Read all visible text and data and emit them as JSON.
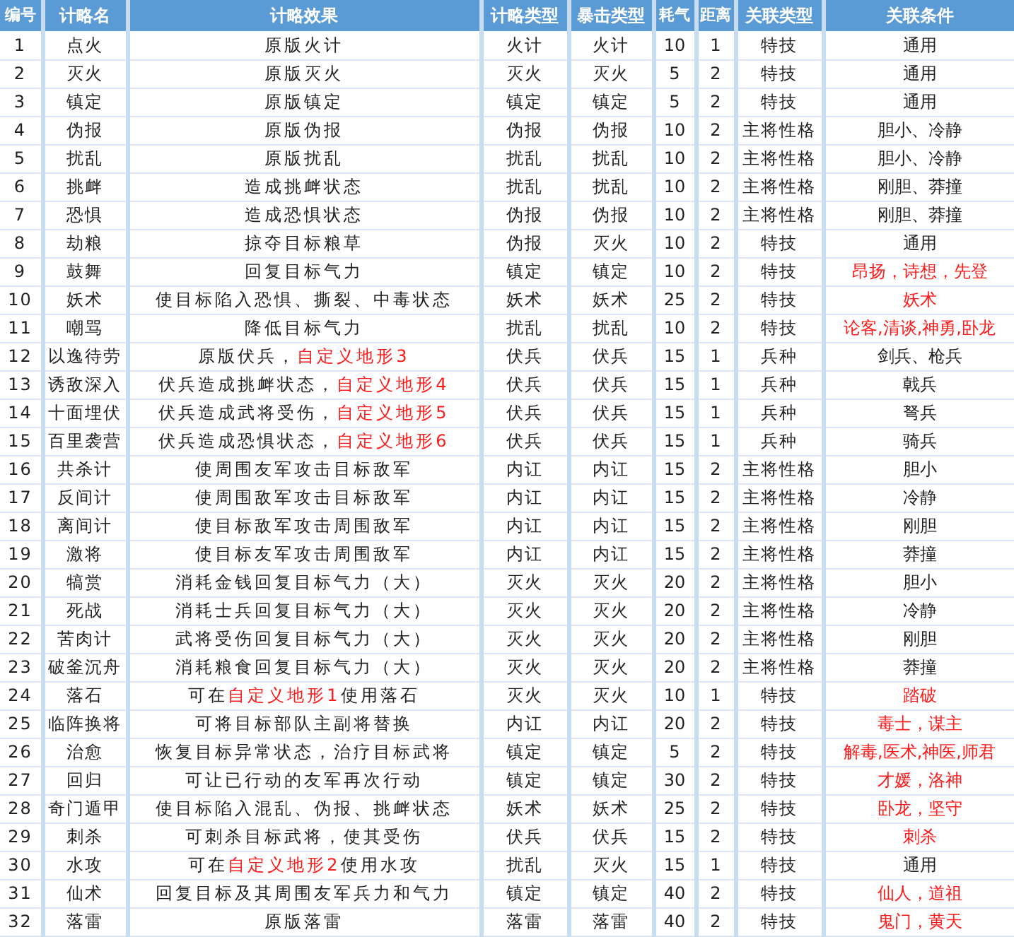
{
  "table": {
    "columns": [
      "编号",
      "计略名",
      "计略效果",
      "计略类型",
      "暴击类型",
      "耗气",
      "距离",
      "关联类型",
      "关联条件"
    ],
    "rows": [
      {
        "no": "1",
        "name": "点火",
        "effect": [
          {
            "text": "原版火计",
            "highlight": false
          }
        ],
        "type": "火计",
        "crit": "火计",
        "cost": "10",
        "range": "1",
        "link": "特技",
        "condition": "通用",
        "condition_highlight": false
      },
      {
        "no": "2",
        "name": "灭火",
        "effect": [
          {
            "text": "原版灭火",
            "highlight": false
          }
        ],
        "type": "灭火",
        "crit": "灭火",
        "cost": "5",
        "range": "2",
        "link": "特技",
        "condition": "通用",
        "condition_highlight": false
      },
      {
        "no": "3",
        "name": "镇定",
        "effect": [
          {
            "text": "原版镇定",
            "highlight": false
          }
        ],
        "type": "镇定",
        "crit": "镇定",
        "cost": "5",
        "range": "2",
        "link": "特技",
        "condition": "通用",
        "condition_highlight": false
      },
      {
        "no": "4",
        "name": "伪报",
        "effect": [
          {
            "text": "原版伪报",
            "highlight": false
          }
        ],
        "type": "伪报",
        "crit": "伪报",
        "cost": "10",
        "range": "2",
        "link": "主将性格",
        "condition": "胆小、冷静",
        "condition_highlight": false
      },
      {
        "no": "5",
        "name": "扰乱",
        "effect": [
          {
            "text": "原版扰乱",
            "highlight": false
          }
        ],
        "type": "扰乱",
        "crit": "扰乱",
        "cost": "10",
        "range": "2",
        "link": "主将性格",
        "condition": "胆小、冷静",
        "condition_highlight": false
      },
      {
        "no": "6",
        "name": "挑衅",
        "effect": [
          {
            "text": "造成挑衅状态",
            "highlight": false
          }
        ],
        "type": "扰乱",
        "crit": "扰乱",
        "cost": "10",
        "range": "2",
        "link": "主将性格",
        "condition": "刚胆、莽撞",
        "condition_highlight": false
      },
      {
        "no": "7",
        "name": "恐惧",
        "effect": [
          {
            "text": "造成恐惧状态",
            "highlight": false
          }
        ],
        "type": "伪报",
        "crit": "伪报",
        "cost": "10",
        "range": "2",
        "link": "主将性格",
        "condition": "刚胆、莽撞",
        "condition_highlight": false
      },
      {
        "no": "8",
        "name": "劫粮",
        "effect": [
          {
            "text": "掠夺目标粮草",
            "highlight": false
          }
        ],
        "type": "伪报",
        "crit": "灭火",
        "cost": "10",
        "range": "2",
        "link": "特技",
        "condition": "通用",
        "condition_highlight": false
      },
      {
        "no": "9",
        "name": "鼓舞",
        "effect": [
          {
            "text": "回复目标气力",
            "highlight": false
          }
        ],
        "type": "镇定",
        "crit": "镇定",
        "cost": "10",
        "range": "2",
        "link": "特技",
        "condition": "昂扬，诗想，先登",
        "condition_highlight": true
      },
      {
        "no": "10",
        "name": "妖术",
        "effect": [
          {
            "text": "使目标陷入恐惧、撕裂、中毒状态",
            "highlight": false
          }
        ],
        "type": "妖术",
        "crit": "妖术",
        "cost": "25",
        "range": "2",
        "link": "特技",
        "condition": "妖术",
        "condition_highlight": true
      },
      {
        "no": "11",
        "name": "嘲骂",
        "effect": [
          {
            "text": "降低目标气力",
            "highlight": false
          }
        ],
        "type": "扰乱",
        "crit": "扰乱",
        "cost": "10",
        "range": "2",
        "link": "特技",
        "condition": "论客,清谈,神勇,卧龙",
        "condition_highlight": true
      },
      {
        "no": "12",
        "name": "以逸待劳",
        "effect": [
          {
            "text": "原版伏兵，",
            "highlight": false
          },
          {
            "text": "自定义地形3",
            "highlight": true
          }
        ],
        "type": "伏兵",
        "crit": "伏兵",
        "cost": "15",
        "range": "1",
        "link": "兵种",
        "condition": "剑兵、枪兵",
        "condition_highlight": false
      },
      {
        "no": "13",
        "name": "诱敌深入",
        "effect": [
          {
            "text": "伏兵造成挑衅状态，",
            "highlight": false
          },
          {
            "text": "自定义地形4",
            "highlight": true
          }
        ],
        "type": "伏兵",
        "crit": "伏兵",
        "cost": "15",
        "range": "1",
        "link": "兵种",
        "condition": "戟兵",
        "condition_highlight": false
      },
      {
        "no": "14",
        "name": "十面埋伏",
        "effect": [
          {
            "text": "伏兵造成武将受伤，",
            "highlight": false
          },
          {
            "text": "自定义地形5",
            "highlight": true
          }
        ],
        "type": "伏兵",
        "crit": "伏兵",
        "cost": "15",
        "range": "1",
        "link": "兵种",
        "condition": "弩兵",
        "condition_highlight": false
      },
      {
        "no": "15",
        "name": "百里袭营",
        "effect": [
          {
            "text": "伏兵造成恐惧状态，",
            "highlight": false
          },
          {
            "text": "自定义地形6",
            "highlight": true
          }
        ],
        "type": "伏兵",
        "crit": "伏兵",
        "cost": "15",
        "range": "1",
        "link": "兵种",
        "condition": "骑兵",
        "condition_highlight": false
      },
      {
        "no": "16",
        "name": "共杀计",
        "effect": [
          {
            "text": "使周围友军攻击目标敌军",
            "highlight": false
          }
        ],
        "type": "内讧",
        "crit": "内讧",
        "cost": "15",
        "range": "2",
        "link": "主将性格",
        "condition": "胆小",
        "condition_highlight": false
      },
      {
        "no": "17",
        "name": "反间计",
        "effect": [
          {
            "text": "使周围敌军攻击目标敌军",
            "highlight": false
          }
        ],
        "type": "内讧",
        "crit": "内讧",
        "cost": "15",
        "range": "2",
        "link": "主将性格",
        "condition": "冷静",
        "condition_highlight": false
      },
      {
        "no": "18",
        "name": "离间计",
        "effect": [
          {
            "text": "使目标敌军攻击周围敌军",
            "highlight": false
          }
        ],
        "type": "内讧",
        "crit": "内讧",
        "cost": "15",
        "range": "2",
        "link": "主将性格",
        "condition": "刚胆",
        "condition_highlight": false
      },
      {
        "no": "19",
        "name": "激将",
        "effect": [
          {
            "text": "使目标友军攻击周围敌军",
            "highlight": false
          }
        ],
        "type": "内讧",
        "crit": "内讧",
        "cost": "15",
        "range": "2",
        "link": "主将性格",
        "condition": "莽撞",
        "condition_highlight": false
      },
      {
        "no": "20",
        "name": "犒赏",
        "effect": [
          {
            "text": "消耗金钱回复目标气力（大）",
            "highlight": false
          }
        ],
        "type": "灭火",
        "crit": "灭火",
        "cost": "20",
        "range": "2",
        "link": "主将性格",
        "condition": "胆小",
        "condition_highlight": false
      },
      {
        "no": "21",
        "name": "死战",
        "effect": [
          {
            "text": "消耗士兵回复目标气力（大）",
            "highlight": false
          }
        ],
        "type": "灭火",
        "crit": "灭火",
        "cost": "20",
        "range": "2",
        "link": "主将性格",
        "condition": "冷静",
        "condition_highlight": false
      },
      {
        "no": "22",
        "name": "苦肉计",
        "effect": [
          {
            "text": "武将受伤回复目标气力（大）",
            "highlight": false
          }
        ],
        "type": "灭火",
        "crit": "灭火",
        "cost": "20",
        "range": "2",
        "link": "主将性格",
        "condition": "刚胆",
        "condition_highlight": false
      },
      {
        "no": "23",
        "name": "破釜沉舟",
        "effect": [
          {
            "text": "消耗粮食回复目标气力（大）",
            "highlight": false
          }
        ],
        "type": "灭火",
        "crit": "灭火",
        "cost": "20",
        "range": "2",
        "link": "主将性格",
        "condition": "莽撞",
        "condition_highlight": false
      },
      {
        "no": "24",
        "name": "落石",
        "effect": [
          {
            "text": "可在",
            "highlight": false
          },
          {
            "text": "自定义地形1",
            "highlight": true
          },
          {
            "text": "使用落石",
            "highlight": false
          }
        ],
        "type": "灭火",
        "crit": "灭火",
        "cost": "10",
        "range": "1",
        "link": "特技",
        "condition": "踏破",
        "condition_highlight": true
      },
      {
        "no": "25",
        "name": "临阵换将",
        "effect": [
          {
            "text": "可将目标部队主副将替换",
            "highlight": false
          }
        ],
        "type": "内讧",
        "crit": "内讧",
        "cost": "20",
        "range": "2",
        "link": "特技",
        "condition": "毒士，谋主",
        "condition_highlight": true
      },
      {
        "no": "26",
        "name": "治愈",
        "effect": [
          {
            "text": "恢复目标异常状态，治疗目标武将",
            "highlight": false
          }
        ],
        "type": "镇定",
        "crit": "镇定",
        "cost": "5",
        "range": "2",
        "link": "特技",
        "condition": "解毒,医术,神医,师君",
        "condition_highlight": true
      },
      {
        "no": "27",
        "name": "回归",
        "effect": [
          {
            "text": "可让已行动的友军再次行动",
            "highlight": false
          }
        ],
        "type": "镇定",
        "crit": "镇定",
        "cost": "30",
        "range": "2",
        "link": "特技",
        "condition": "才媛，洛神",
        "condition_highlight": true
      },
      {
        "no": "28",
        "name": "奇门遁甲",
        "effect": [
          {
            "text": "使目标陷入混乱、伪报、挑衅状态",
            "highlight": false
          }
        ],
        "type": "妖术",
        "crit": "妖术",
        "cost": "25",
        "range": "2",
        "link": "特技",
        "condition": "卧龙，坚守",
        "condition_highlight": true
      },
      {
        "no": "29",
        "name": "刺杀",
        "effect": [
          {
            "text": "可刺杀目标武将，使其受伤",
            "highlight": false
          }
        ],
        "type": "伏兵",
        "crit": "伏兵",
        "cost": "15",
        "range": "2",
        "link": "特技",
        "condition": "刺杀",
        "condition_highlight": true
      },
      {
        "no": "30",
        "name": "水攻",
        "effect": [
          {
            "text": "可在",
            "highlight": false
          },
          {
            "text": "自定义地形2",
            "highlight": true
          },
          {
            "text": "使用水攻",
            "highlight": false
          }
        ],
        "type": "扰乱",
        "crit": "灭火",
        "cost": "15",
        "range": "1",
        "link": "特技",
        "condition": "通用",
        "condition_highlight": false
      },
      {
        "no": "31",
        "name": "仙术",
        "effect": [
          {
            "text": "回复目标及其周围友军兵力和气力",
            "highlight": false
          }
        ],
        "type": "镇定",
        "crit": "镇定",
        "cost": "40",
        "range": "2",
        "link": "特技",
        "condition": "仙人，道祖",
        "condition_highlight": true
      },
      {
        "no": "32",
        "name": "落雷",
        "effect": [
          {
            "text": "原版落雷",
            "highlight": false
          }
        ],
        "type": "落雷",
        "crit": "落雷",
        "cost": "40",
        "range": "2",
        "link": "特技",
        "condition": "鬼门，黄天",
        "condition_highlight": true
      }
    ]
  }
}
